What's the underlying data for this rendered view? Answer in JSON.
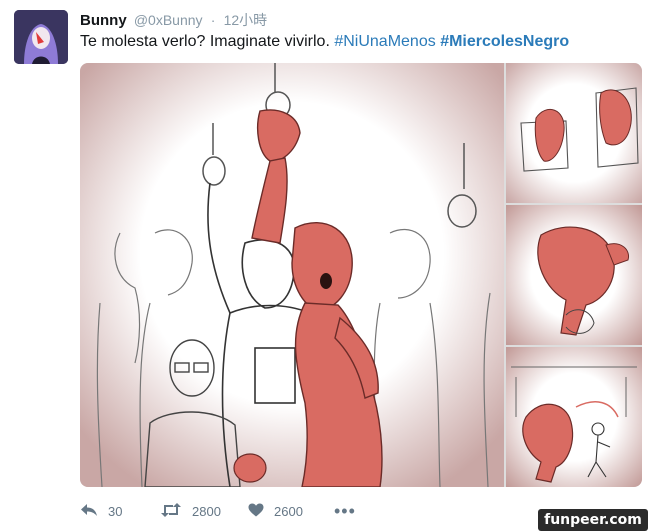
{
  "tweet": {
    "display_name": "Bunny",
    "handle": "@0xBunny",
    "separator": "·",
    "timestamp": "12小時",
    "text_plain": "Te molesta verlo? Imaginate vivirlo.",
    "hashtag_1": "#NiUnaMenos",
    "hashtag_2": "#MiercolesNegro"
  },
  "actions": {
    "reply_icon": "reply-icon",
    "reply_count": "30",
    "retweet_icon": "retweet-icon",
    "retweet_count": "2800",
    "like_icon": "heart-icon",
    "like_count": "2600",
    "more_icon": "more-icon",
    "more_label": "•••"
  },
  "colors": {
    "hashtag": "#2b7bb9",
    "meta_gray": "#8899a6",
    "action_gray": "#657786",
    "monster_red": "#d96b62"
  },
  "watermark": {
    "text": "funpeer.com"
  }
}
